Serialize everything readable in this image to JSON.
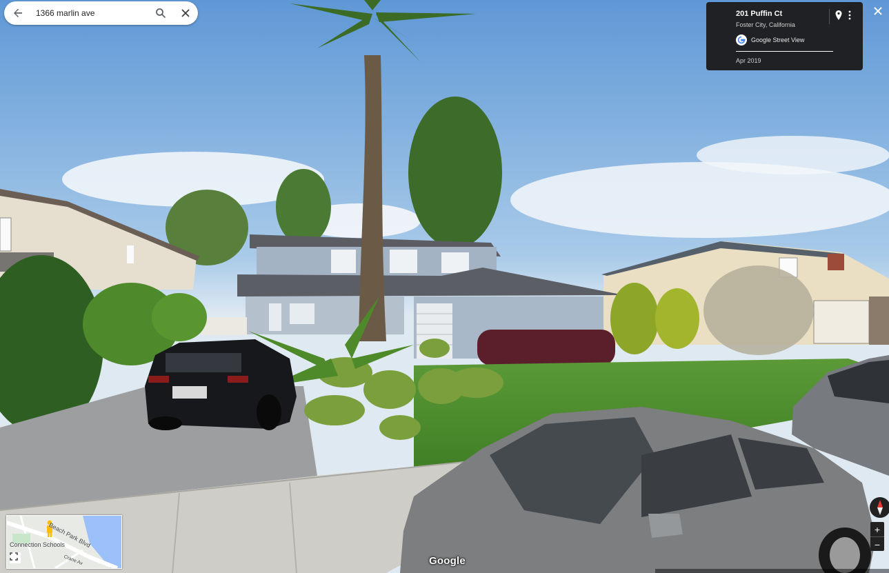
{
  "search": {
    "query": "1366 marlin ave"
  },
  "info_card": {
    "title": "201 Puffin Ct",
    "subtitle": "Foster City, California",
    "provider": "Google Street View",
    "date": "Apr 2019"
  },
  "minimap": {
    "street_label": "Beach Park Blvd",
    "place_label": "Connection Schools",
    "small_label": "Crane Av"
  },
  "zoom": {
    "in_label": "+",
    "out_label": "−"
  },
  "watermark": "Google",
  "colors": {
    "card_bg": "#202124",
    "water": "#9cc0f9",
    "pegman": "#fbbc04"
  },
  "icons": [
    "back-arrow-icon",
    "search-icon",
    "close-icon",
    "google-g-icon",
    "pin-icon",
    "more-vert-icon",
    "expand-icon",
    "compass-icon",
    "pegman-icon"
  ]
}
